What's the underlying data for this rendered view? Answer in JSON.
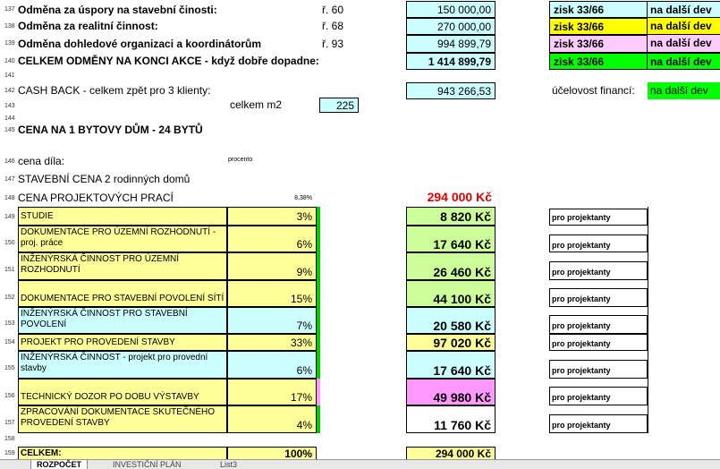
{
  "rows": {
    "r137": {
      "num": "137",
      "label": "Odměna za úspory na stavební činosti:",
      "ref": "ř. 60",
      "amount": "150 000,00",
      "zisk": "zisk 33/66",
      "next": "na další dev"
    },
    "r138": {
      "num": "138",
      "label": "Odměna za realitní činnost:",
      "ref": "ř. 68",
      "amount": "270 000,00",
      "zisk": "zisk 33/66",
      "next": "na další dev"
    },
    "r139": {
      "num": "139",
      "label": "Odměna dohledové organizaci a koordinátorům",
      "ref": "ř. 93",
      "amount": "994 899,79",
      "zisk": "zisk 33/66",
      "next": "na další dev"
    },
    "r140": {
      "num": "140",
      "label": "CELKEM ODMĚNY NA KONCI AKCE - když dobře dopadne:",
      "amount": "1 414 899,79",
      "zisk": "zisk 33/66",
      "next": "na další dev"
    },
    "r141": {
      "num": "141"
    },
    "r142": {
      "num": "142",
      "label": "CASH BACK - celkem zpět pro 3 klienty:",
      "amount": "943 266,53",
      "info": "účelovost financí:",
      "next": "na další dev"
    },
    "r143": {
      "num": "143",
      "label": "celkem m2",
      "value": "225"
    },
    "r144": {
      "num": "144"
    },
    "r145": {
      "num": "145",
      "label": "CENA NA 1 BYTOVY DŮM - 24 BYTŮ"
    },
    "r146": {
      "num": "146",
      "label": "cena díla:",
      "note": "procento"
    },
    "r147": {
      "num": "147",
      "label": "STAVEBNÍ CENA 2 rodinných domů"
    },
    "r148": {
      "num": "148",
      "label": "CENA PROJEKTOVÝCH PRACÍ",
      "pct": "8,38%",
      "amount": "294 000 Kč"
    },
    "r149": {
      "num": "149",
      "label": "STUDIE",
      "pct": "3%",
      "amount": "8 820 Kč",
      "note": "pro projektanty"
    },
    "r150": {
      "num": "150",
      "label": "DOKUMENTACE PRO ÚZEMNÍ ROZHODNUTÍ - proj. práce",
      "pct": "6%",
      "amount": "17 640 Kč",
      "note": "pro projektanty"
    },
    "r151": {
      "num": "151",
      "label": "INŽENÝRSKÁ ČINNOST PRO ÚZEMNÍ ROZHODNUTÍ",
      "pct": "9%",
      "amount": "26 460 Kč",
      "note": "pro projektanty"
    },
    "r152": {
      "num": "152",
      "label": "DOKUMENTACE PRO STAVEBNÍ POVOLENÍ SÍTÍ",
      "pct": "15%",
      "amount": "44 100 Kč",
      "note": "pro projektanty"
    },
    "r153": {
      "num": "153",
      "label": "INŽENÝRSKÁ ČINNOST PRO STAVEBNÍ POVOLENÍ",
      "pct": "7%",
      "amount": "20 580 Kč",
      "note": "pro projektanty"
    },
    "r154": {
      "num": "154",
      "label": "PROJEKT PRO PROVEDENÍ STAVBY",
      "pct": "33%",
      "amount": "97 020 Kč",
      "note": "pro projektanty"
    },
    "r155": {
      "num": "155",
      "label": "INŽENÝRSKÁ ČINNOST - projekt pro provední stavby",
      "pct": "6%",
      "amount": "17 640 Kč",
      "note": "pro projektanty"
    },
    "r156": {
      "num": "156",
      "label": "TECHNICKÝ DOZOR PO DOBU VÝSTAVBY",
      "pct": "17%",
      "amount": "49 980 Kč",
      "note": "pro projektanty"
    },
    "r157": {
      "num": "157",
      "label": "ZPRACOVÁNÍ DOKUMENTACE SKUTEČNÉHO PROVEDENÍ STAVBY",
      "pct": "4%",
      "amount": "11 760 Kč",
      "note": "pro projektanty"
    },
    "r158": {
      "num": "158"
    },
    "r159": {
      "num": "159",
      "label": "CELKEM:",
      "pct": "100%",
      "amount": "294 000 Kč"
    }
  },
  "tabs": [
    "ROZPOČET",
    "INVESTIČNÍ PLÁN",
    "List3"
  ],
  "colors": {
    "red": "#e00000",
    "green": "#00ff00",
    "yellow": "#ffff00"
  }
}
